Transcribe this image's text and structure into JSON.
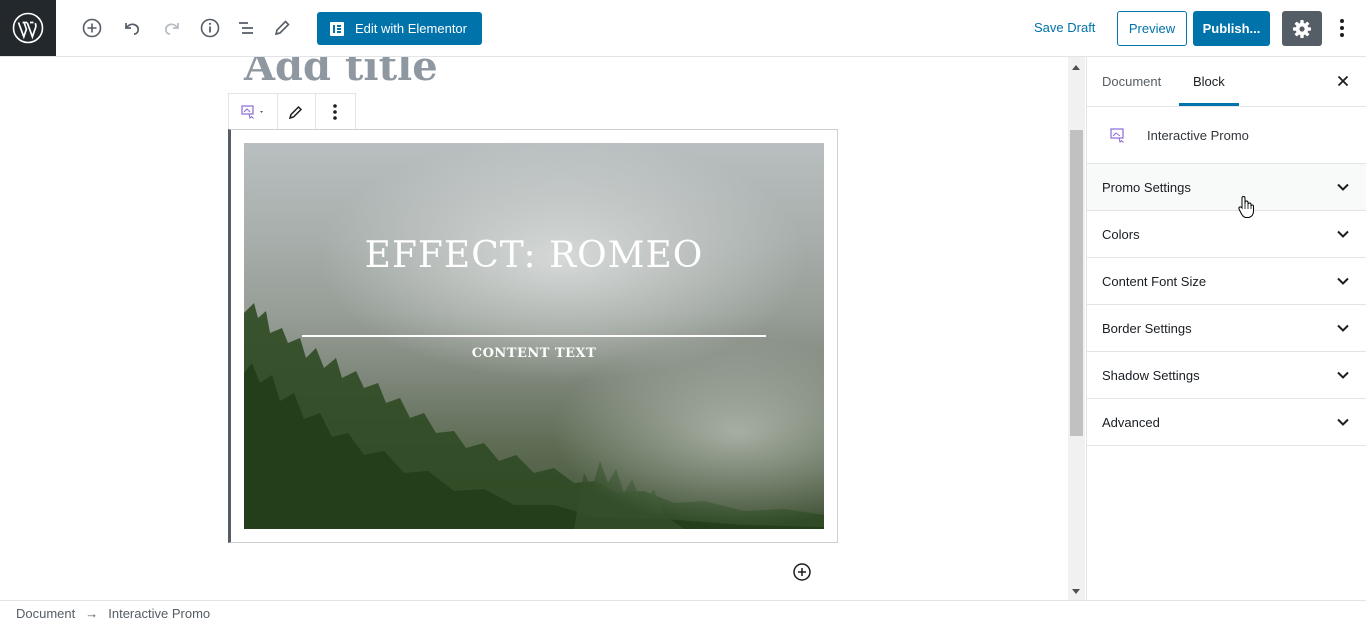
{
  "toolbar": {
    "elementor_label": "Edit with Elementor",
    "save_draft_label": "Save Draft",
    "preview_label": "Preview",
    "publish_label": "Publish...",
    "accent_color": "#0073aa"
  },
  "editor": {
    "title_placeholder": "Add title",
    "promo": {
      "title": "EFFECT:  ROMEO",
      "content": "CONTENT TEXT"
    }
  },
  "sidebar": {
    "tabs": [
      {
        "label": "Document",
        "active": false
      },
      {
        "label": "Block",
        "active": true
      }
    ],
    "block_name": "Interactive Promo",
    "panels": [
      {
        "label": "Promo Settings"
      },
      {
        "label": "Colors"
      },
      {
        "label": "Content Font Size"
      },
      {
        "label": "Border Settings"
      },
      {
        "label": "Shadow Settings"
      },
      {
        "label": "Advanced"
      }
    ]
  },
  "breadcrumb": {
    "root": "Document",
    "separator": "→",
    "current": "Interactive Promo"
  }
}
